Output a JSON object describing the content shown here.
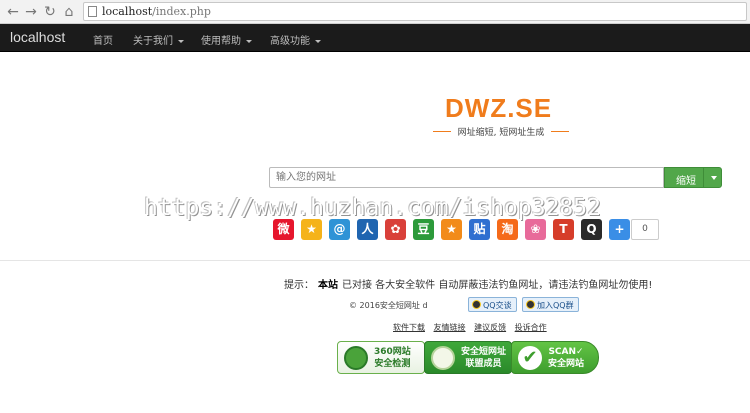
{
  "browser": {
    "url_host": "localhost",
    "url_path": "/index.php"
  },
  "navbar": {
    "brand": "localhost",
    "items": [
      {
        "label": "首页",
        "dropdown": false
      },
      {
        "label": "关于我们",
        "dropdown": true
      },
      {
        "label": "使用帮助",
        "dropdown": true
      },
      {
        "label": "高级功能",
        "dropdown": true
      }
    ]
  },
  "logo": {
    "text": "DWZ.SE",
    "subtitle": "网址缩短, 短网址生成"
  },
  "search": {
    "placeholder": "输入您的网址",
    "button_label": "缩短"
  },
  "watermark": "https://www.huzhan.com/ishop32852",
  "share": {
    "icons": [
      {
        "name": "weibo-icon",
        "glyph": "微",
        "color": "#e6162d"
      },
      {
        "name": "qzone-icon",
        "glyph": "★",
        "color": "#f5b31a"
      },
      {
        "name": "tencent-weibo-icon",
        "glyph": "@",
        "color": "#2f93d6"
      },
      {
        "name": "renren-icon",
        "glyph": "人",
        "color": "#1f65b0"
      },
      {
        "name": "kaixin-icon",
        "glyph": "✿",
        "color": "#d9403a"
      },
      {
        "name": "douban-icon",
        "glyph": "豆",
        "color": "#2c9a3a"
      },
      {
        "name": "star-icon",
        "glyph": "★",
        "color": "#f28b1a"
      },
      {
        "name": "tieba-icon",
        "glyph": "贴",
        "color": "#2f6fd0"
      },
      {
        "name": "taobao-icon",
        "glyph": "淘",
        "color": "#f56a1a"
      },
      {
        "name": "flower-icon",
        "glyph": "❀",
        "color": "#e86a9a"
      },
      {
        "name": "tianya-icon",
        "glyph": "T",
        "color": "#d63d2a"
      },
      {
        "name": "qq-icon",
        "glyph": "Q",
        "color": "#2a2a2a"
      },
      {
        "name": "more-icon",
        "glyph": "+",
        "color": "#3a8ee6"
      }
    ],
    "count": "0"
  },
  "footer": {
    "tip_prefix": "提示：",
    "tip_bold": "本站",
    "tip_text": "已对接 各大安全软件 自动屏蔽违法钓鱼网址，请违法钓鱼网址勿使用!",
    "copyright": "© 2016安全短网址 d",
    "qq_chat": "QQ交谈",
    "qq_group": "加入QQ群",
    "links": [
      "软件下载",
      "友情链接",
      "建议反馈",
      "投诉合作"
    ],
    "badges": [
      {
        "line1": "360网站",
        "line2": "安全检测"
      },
      {
        "line1": "安全短网址",
        "line2": "联盟成员"
      },
      {
        "line1": "SCAN✓",
        "line2": "安全网站"
      }
    ]
  },
  "colors": {
    "navbar_bg": "#1b1b1b",
    "logo_orange": "#f07c1c",
    "button_green": "#52a74a"
  }
}
